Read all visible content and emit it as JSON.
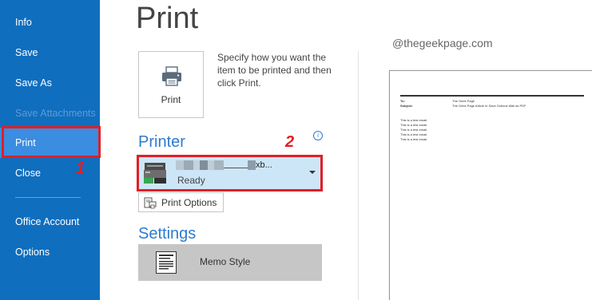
{
  "sidebar": {
    "items": [
      {
        "label": "Info",
        "state": "normal"
      },
      {
        "label": "Save",
        "state": "normal"
      },
      {
        "label": "Save As",
        "state": "normal"
      },
      {
        "label": "Save Attachments",
        "state": "disabled"
      },
      {
        "label": "Print",
        "state": "selected"
      },
      {
        "label": "Close",
        "state": "normal"
      },
      {
        "label": "Office Account",
        "state": "normal"
      },
      {
        "label": "Options",
        "state": "normal"
      }
    ]
  },
  "page": {
    "title": "Print"
  },
  "print_button": {
    "label": "Print",
    "icon": "printer-icon"
  },
  "print_description": "Specify how you want the item to be printed and then click Print.",
  "printer": {
    "section_title": "Printer",
    "name_suffix": "xb...",
    "status": "Ready",
    "info_icon": "i"
  },
  "print_options": {
    "label": "Print Options"
  },
  "settings": {
    "section_title": "Settings",
    "style_label": "Memo Style"
  },
  "annotations": {
    "step1": "1",
    "step2": "2",
    "color": "#e01f26"
  },
  "preview": {
    "watermark": "@thegeekpage.com",
    "to_label": "To:",
    "to_value": "The Geek Page",
    "subject_label": "Subject:",
    "subject_value": "The Geek Page Article to Save Outlook Mail as PDF",
    "body_lines": [
      "This is a test email.",
      "This is a test email.",
      "This is a test email.",
      "This is a test email.",
      "This is a test email."
    ]
  },
  "colors": {
    "sidebar": "#106ebe",
    "selected": "#3a8de0",
    "accent": "#2e7bcf",
    "printer_bg": "#cde6f7"
  }
}
